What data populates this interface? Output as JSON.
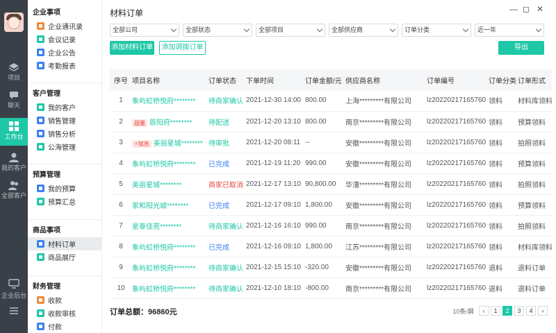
{
  "rail": {
    "items": [
      {
        "label": "项目",
        "icon": "layers-icon"
      },
      {
        "label": "聊天",
        "icon": "chat-icon"
      },
      {
        "label": "工作台",
        "icon": "grid-icon"
      },
      {
        "label": "我的客户",
        "icon": "user-icon"
      },
      {
        "label": "全部客户",
        "icon": "users-icon"
      }
    ],
    "bottom": {
      "label": "企业后台",
      "icon": "monitor-icon"
    }
  },
  "sidebar": {
    "sections": [
      {
        "title": "企业事项",
        "items": [
          {
            "label": "企业通讯录",
            "color": "#f08a3c"
          },
          {
            "label": "会议记录",
            "color": "#1ec7a6"
          },
          {
            "label": "企业公告",
            "color": "#3b82f6"
          },
          {
            "label": "考勤报表",
            "color": "#3b82f6"
          }
        ]
      },
      {
        "title": "客户管理",
        "items": [
          {
            "label": "我的客户",
            "color": "#1ec7a6"
          },
          {
            "label": "销售管理",
            "color": "#3b82f6"
          },
          {
            "label": "销售分析",
            "color": "#3b82f6"
          },
          {
            "label": "公海管理",
            "color": "#1ec7a6"
          }
        ]
      },
      {
        "title": "预算管理",
        "items": [
          {
            "label": "我的预算",
            "color": "#3b82f6"
          },
          {
            "label": "预算汇总",
            "color": "#1ec7a6"
          }
        ]
      },
      {
        "title": "商品事项",
        "items": [
          {
            "label": "材料订单",
            "color": "#3b82f6"
          },
          {
            "label": "商品展厅",
            "color": "#1ec7a6"
          }
        ]
      },
      {
        "title": "财务管理",
        "items": [
          {
            "label": "收款",
            "color": "#f08a3c"
          },
          {
            "label": "收款审核",
            "color": "#1ec7a6"
          },
          {
            "label": "付款",
            "color": "#3b82f6"
          }
        ]
      }
    ]
  },
  "main": {
    "title": "材料订单",
    "filters": [
      "全部公司",
      "全部状态",
      "全部项目",
      "全部供应商",
      "订单分类",
      "近一年"
    ],
    "add_material_label": "添加材料订单",
    "add_transfer_label": "添加调拨订单",
    "export_label": "导出",
    "columns": [
      "序号",
      "项目名称",
      "订单状态",
      "下单时间",
      "订单金额/元",
      "供应商名称",
      "订单编号",
      "订单分类",
      "订单形式"
    ],
    "rows": [
      {
        "no": "1",
        "tag": "",
        "project": "象屿虹桥悦府********",
        "status": "待商家确认",
        "status_color": "green",
        "time": "2021-12-30 14:00",
        "amount": "800.00",
        "supplier": "上海*********有限公司",
        "order_no": "lz20220217165760",
        "category": "领料",
        "form": "材料库领料"
      },
      {
        "no": "2",
        "tag": "超量",
        "project": "辰阳府********",
        "status": "待配送",
        "status_color": "green",
        "time": "2021-12-20 13:10",
        "amount": "800.00",
        "supplier": "南京*********有限公司",
        "order_no": "lz20220217165760",
        "category": "领料",
        "form": "预算领料"
      },
      {
        "no": "3",
        "tag": "加急",
        "project": "美丽星城********",
        "status": "待审批",
        "status_color": "green",
        "time": "2021-12-20 08:11",
        "amount": "--",
        "supplier": "安徽*********有限公司",
        "order_no": "lz20220217165760",
        "category": "领料",
        "form": "拍照领料"
      },
      {
        "no": "4",
        "tag": "",
        "project": "象屿虹桥悦府********",
        "status": "已完成",
        "status_color": "blue",
        "time": "2021-12-19 11:20",
        "amount": "990.00",
        "supplier": "安徽*********有限公司",
        "order_no": "lz20220217165760",
        "category": "领料",
        "form": "预算领料"
      },
      {
        "no": "5",
        "tag": "",
        "project": "美丽星城********",
        "status": "商家已取消",
        "status_color": "red",
        "time": "2021-12-17 13:10",
        "amount": "90,800.00",
        "supplier": "华漕*********有限公司",
        "order_no": "lz20220217165760",
        "category": "领料",
        "form": "拍照领料"
      },
      {
        "no": "6",
        "tag": "",
        "project": "家和阳光城********",
        "status": "已完成",
        "status_color": "blue",
        "time": "2021-12-17 09:10",
        "amount": "1,800.00",
        "supplier": "安徽*********有限公司",
        "order_no": "lz20220217165760",
        "category": "领料",
        "form": "预算领料"
      },
      {
        "no": "7",
        "tag": "",
        "project": "星泰佳苑********",
        "status": "待商家确认",
        "status_color": "green",
        "time": "2021-12-16 16:10",
        "amount": "990.00",
        "supplier": "南京*********有限公司",
        "order_no": "lz20220217165760",
        "category": "领料",
        "form": "拍照领料"
      },
      {
        "no": "8",
        "tag": "",
        "project": "象屿虹桥悦府********",
        "status": "已完成",
        "status_color": "blue",
        "time": "2021-12-16 09:10",
        "amount": "1,800.00",
        "supplier": "江苏*********有限公司",
        "order_no": "lz20220217165760",
        "category": "领料",
        "form": "材料库领料"
      },
      {
        "no": "9",
        "tag": "",
        "project": "象屿虹桥悦府********",
        "status": "待商家确认",
        "status_color": "green",
        "time": "2021-12-15 15:10",
        "amount": "-320.00",
        "supplier": "安徽*********有限公司",
        "order_no": "lz20220217165760",
        "category": "退料",
        "form": "退料订单"
      },
      {
        "no": "10",
        "tag": "",
        "project": "象屿虹桥悦府********",
        "status": "待商家确认",
        "status_color": "green",
        "time": "2021-12-10 18:10",
        "amount": "-800.00",
        "supplier": "南京*********有限公司",
        "order_no": "lz20220217165760",
        "category": "退料",
        "form": "退料订单"
      }
    ],
    "total_label": "订单总额：",
    "total_value": "96860元",
    "pager": {
      "per_page": "10条/屏",
      "pages": [
        "1",
        "2",
        "3",
        "4"
      ],
      "current": "2"
    }
  }
}
